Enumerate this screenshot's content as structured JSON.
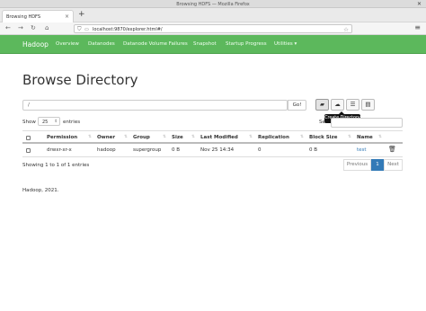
{
  "browser": {
    "window_title": "Browsing HDFS — Mozilla Firefox",
    "tab_title": "Browsing HDFS",
    "url": "localhost:9870/explorer.html#/"
  },
  "nav": {
    "brand": "Hadoop",
    "items": [
      "Overview",
      "Datanodes",
      "Datanode Volume Failures",
      "Snapshot",
      "Startup Progress",
      "Utilities ▾"
    ]
  },
  "page": {
    "title": "Browse Directory",
    "path_value": "/",
    "go_label": "Go!",
    "tooltip": "Create Directory",
    "show_label": "Show",
    "page_size": "25",
    "entries_label": "entries",
    "search_label": "Se"
  },
  "table": {
    "headers": [
      "Permission",
      "Owner",
      "Group",
      "Size",
      "Last Modified",
      "Replication",
      "Block Size",
      "Name"
    ],
    "rows": [
      {
        "permission": "drwxr-xr-x",
        "owner": "hadoop",
        "group": "supergroup",
        "size": "0 B",
        "modified": "Nov 25 14:34",
        "replication": "0",
        "block_size": "0 B",
        "name": "test"
      }
    ]
  },
  "footer_info": "Showing 1 to 1 of 1 entries",
  "pagination": {
    "previous": "Previous",
    "current": "1",
    "next": "Next"
  },
  "footer": "Hadoop, 2021."
}
